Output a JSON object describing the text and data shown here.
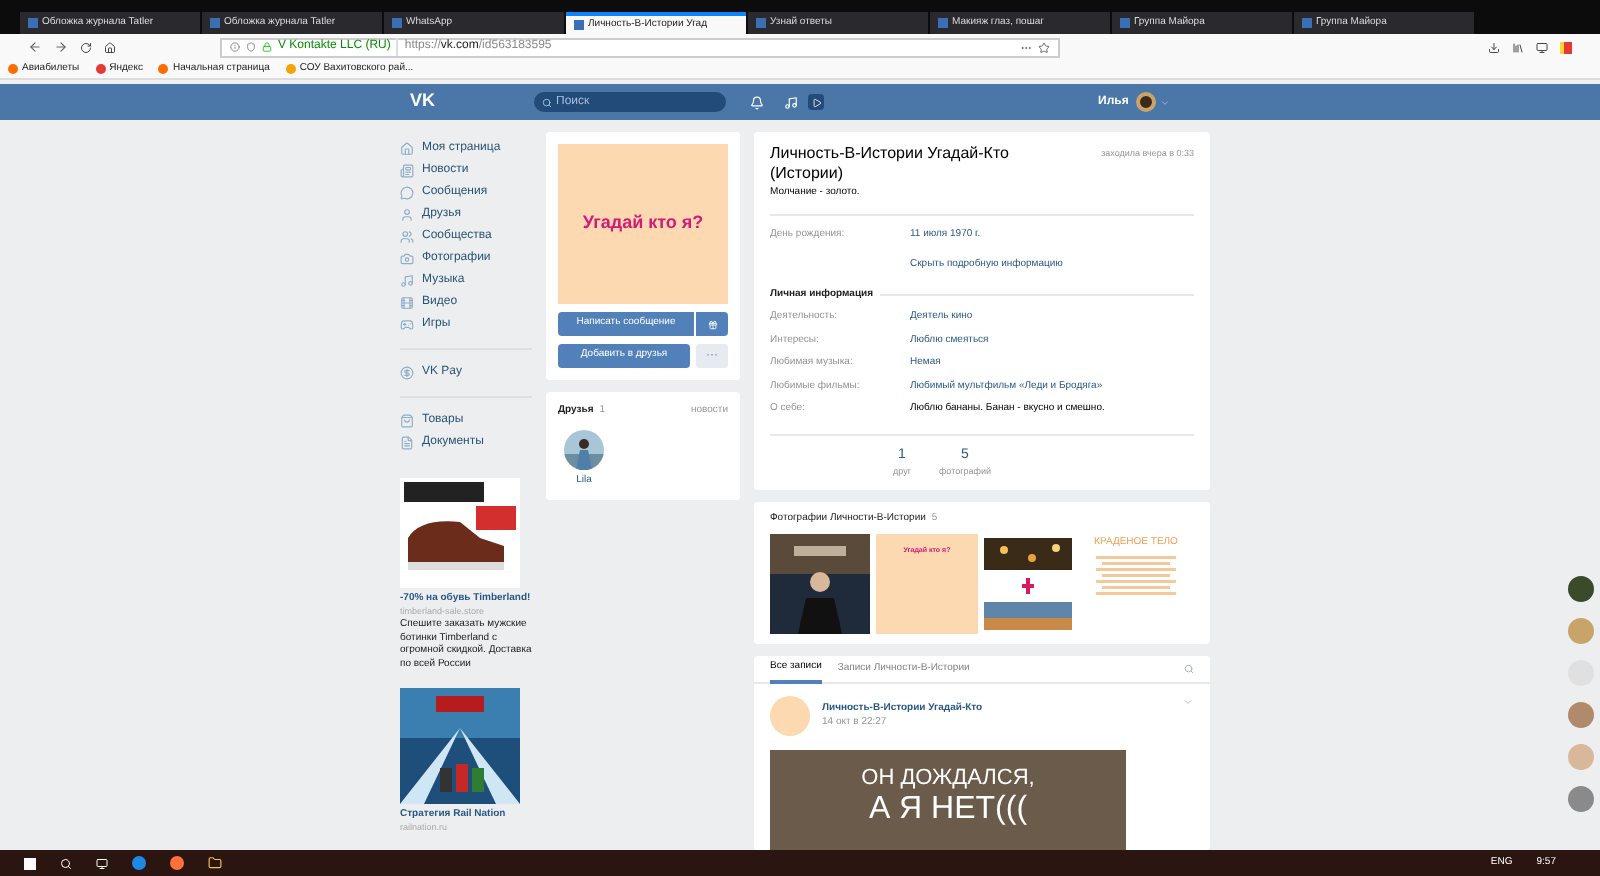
{
  "browser": {
    "tabs": [
      {
        "title": "Обложка журнала Tatler",
        "selected": false
      },
      {
        "title": "Обложка журнала Tatler",
        "selected": false
      },
      {
        "title": "WhatsApp",
        "selected": false
      },
      {
        "title": "Личность-В-Истории Угад",
        "selected": true
      },
      {
        "title": "Узнай ответы",
        "selected": false
      },
      {
        "title": "Макияж глаз, пошаг",
        "selected": false
      },
      {
        "title": "Группа Майора",
        "selected": false
      },
      {
        "title": "Группа Майора",
        "selected": false
      }
    ],
    "site_identity": "V Kontakte LLC (RU)",
    "url_prefix": "https://",
    "url_domain": "vk.com",
    "url_path": "/id563183595",
    "bookmarks": [
      "Авиабилеты",
      "Яндекс",
      "Начальная страница",
      "СОУ Вахитовского рай..."
    ]
  },
  "header": {
    "logo": "VK",
    "search_placeholder": "Поиск",
    "user_name": "Илья"
  },
  "menu": [
    {
      "label": "Моя страница"
    },
    {
      "label": "Новости"
    },
    {
      "label": "Сообщения"
    },
    {
      "label": "Друзья"
    },
    {
      "label": "Сообщества"
    },
    {
      "label": "Фотографии"
    },
    {
      "label": "Музыка"
    },
    {
      "label": "Видео"
    },
    {
      "label": "Игры"
    }
  ],
  "menu_extra": [
    {
      "label": "VK Pay"
    }
  ],
  "menu_more": [
    {
      "label": "Товары"
    },
    {
      "label": "Документы"
    }
  ],
  "ads": [
    {
      "title": "-70% на обувь Timberland!",
      "domain": "timberland-sale.store",
      "text": "Спешите заказать мужские ботинки Timberland с огромной скидкой. Доставка по всей России"
    },
    {
      "title": "Стратегия Rail Nation",
      "domain": "railnation.ru"
    }
  ],
  "profile_photo": {
    "caption": "Угадай кто я?"
  },
  "actions": {
    "message": "Написать сообщение",
    "add_friend": "Добавить в друзья",
    "more": "···"
  },
  "friends": {
    "title": "Друзья",
    "count": "1",
    "link": "новости",
    "items": [
      {
        "name": "Lila"
      }
    ]
  },
  "profile": {
    "name": "Личность-В-Истории Угадай-Кто (Истории)",
    "status": "Молчание - золото.",
    "last_seen": "заходила вчера в 0:33",
    "birthday": {
      "label": "День рождения:",
      "value": "11 июля 1970 г."
    },
    "toggle": "Скрыть подробную информацию",
    "section": "Личная информация",
    "fields": [
      {
        "label": "Деятельность:",
        "value": "Деятель кино",
        "link": true
      },
      {
        "label": "Интересы:",
        "value": "Люблю смеяться",
        "link": true
      },
      {
        "label": "Любимая музыка:",
        "value": "Немая",
        "link": true
      },
      {
        "label": "Любимые фильмы:",
        "value": "Любимый мультфильм «Леди и Бродяга»",
        "link": true
      },
      {
        "label": "О себе:",
        "value": "Люблю бананы. Банан - вкусно и смешно.",
        "link": false
      }
    ],
    "counters": [
      {
        "value": "1",
        "label": "друг"
      },
      {
        "value": "5",
        "label": "фотографий"
      }
    ]
  },
  "photos": {
    "title": "Фотографии Личности-В-Истории",
    "count": "5",
    "items": [
      {
        "kind": "picture"
      },
      {
        "kind": "guess",
        "caption": "Угадай кто я?"
      },
      {
        "kind": "picture"
      },
      {
        "kind": "stolen",
        "caption": "КРАДЕНОЕ ТЕЛО"
      }
    ]
  },
  "wall": {
    "tabs": [
      {
        "label": "Все записи",
        "selected": true
      },
      {
        "label": "Записи Личности-В-Истории",
        "selected": false
      }
    ],
    "post": {
      "author": "Личность-В-Истории Угадай-Кто",
      "date": "14 окт в 22:27",
      "image_lines": [
        "ОН ДОЖДАЛСЯ,",
        "А Я НЕТ((("
      ]
    }
  },
  "taskbar": {
    "language": "ENG",
    "time": "9:57"
  }
}
